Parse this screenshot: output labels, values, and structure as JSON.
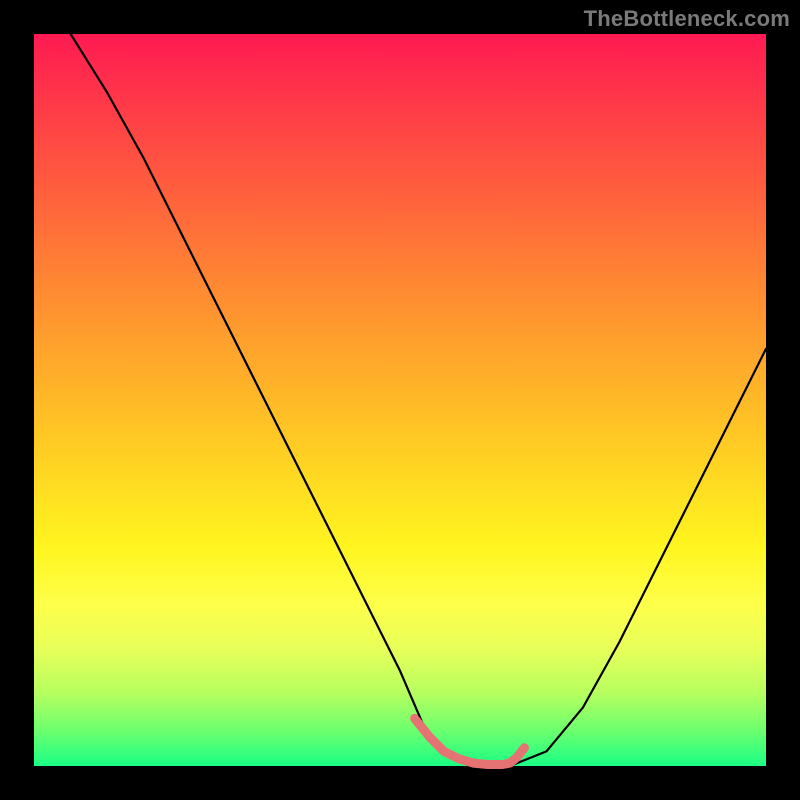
{
  "watermark": "TheBottleneck.com",
  "chart_data": {
    "type": "line",
    "title": "",
    "xlabel": "",
    "ylabel": "",
    "xlim": [
      0,
      100
    ],
    "ylim": [
      0,
      100
    ],
    "background": "rainbow-vertical-gradient",
    "curve_color": "#000000",
    "series": [
      {
        "name": "bottleneck-curve",
        "x": [
          5,
          10,
          15,
          20,
          25,
          30,
          35,
          40,
          45,
          50,
          53,
          56,
          60,
          63,
          65,
          70,
          75,
          80,
          85,
          90,
          95,
          100
        ],
        "y": [
          100,
          92,
          83,
          73,
          63,
          53,
          43,
          33,
          23,
          13,
          6,
          2,
          0,
          0,
          0,
          2,
          8,
          17,
          27,
          37,
          47,
          57
        ]
      }
    ],
    "accent_segment": {
      "name": "highlight",
      "color": "#e57373",
      "x": [
        52,
        54,
        56,
        58,
        60,
        62,
        63,
        64,
        65,
        66,
        67
      ],
      "y": [
        6.5,
        4.0,
        2.0,
        1.0,
        0.4,
        0.2,
        0.2,
        0.2,
        0.4,
        1.2,
        2.5
      ]
    }
  }
}
